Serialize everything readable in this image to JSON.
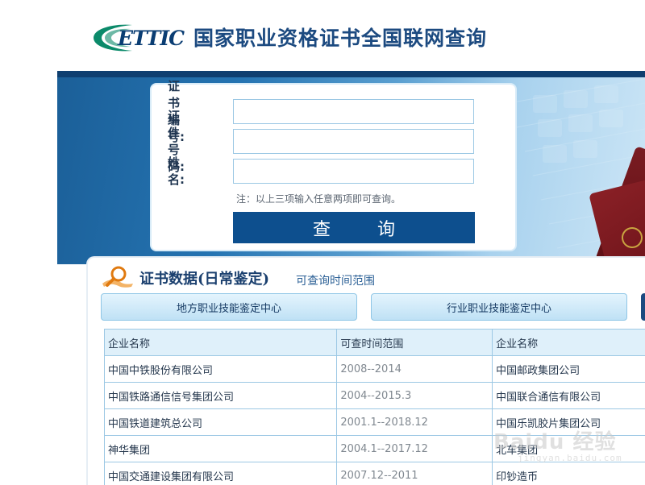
{
  "header": {
    "logo_text": "ETTIC",
    "title": "国家职业资格证书全国联网查询"
  },
  "search_form": {
    "fields": [
      {
        "label": "证书编号:",
        "value": "",
        "placeholder": ""
      },
      {
        "label": "证件号码:",
        "value": "",
        "placeholder": ""
      },
      {
        "label": "姓　　名:",
        "value": "",
        "placeholder": ""
      }
    ],
    "note": "注：以上三项输入任意两项即可查询。",
    "submit_label": "查　询"
  },
  "data_section": {
    "title": "证书数据(日常鉴定)",
    "subtitle": "可查询时间范围",
    "tabs": [
      {
        "label": "地方职业技能鉴定中心"
      },
      {
        "label": "行业职业技能鉴定中心"
      },
      {
        "label": ""
      }
    ],
    "table": {
      "headers": [
        "企业名称",
        "可查时间范围",
        "企业名称"
      ],
      "rows": [
        [
          "中国中铁股份有限公司",
          "2008--2014",
          "中国邮政集团公司"
        ],
        [
          "中国铁路通信信号集团公司",
          "2004--2015.3",
          "中国联合通信有限公司"
        ],
        [
          "中国铁道建筑总公司",
          "2001.1--2018.12",
          "中国乐凯胶片集团公司"
        ],
        [
          "神华集团",
          "2004.1--2017.12",
          "北车集团"
        ],
        [
          "中国交通建设集团有限公司",
          "2007.12--2011",
          "印钞造币"
        ]
      ]
    }
  },
  "watermark": {
    "text": "Baidu 经验",
    "sub": "jingyan.baidu.com"
  },
  "colors": {
    "brand_navy": "#1c4a80",
    "button_blue": "#0d4f8e",
    "banner_blue": "#2574b2",
    "table_border": "#9cc8e4",
    "table_header_bg": "#dff0fa"
  }
}
